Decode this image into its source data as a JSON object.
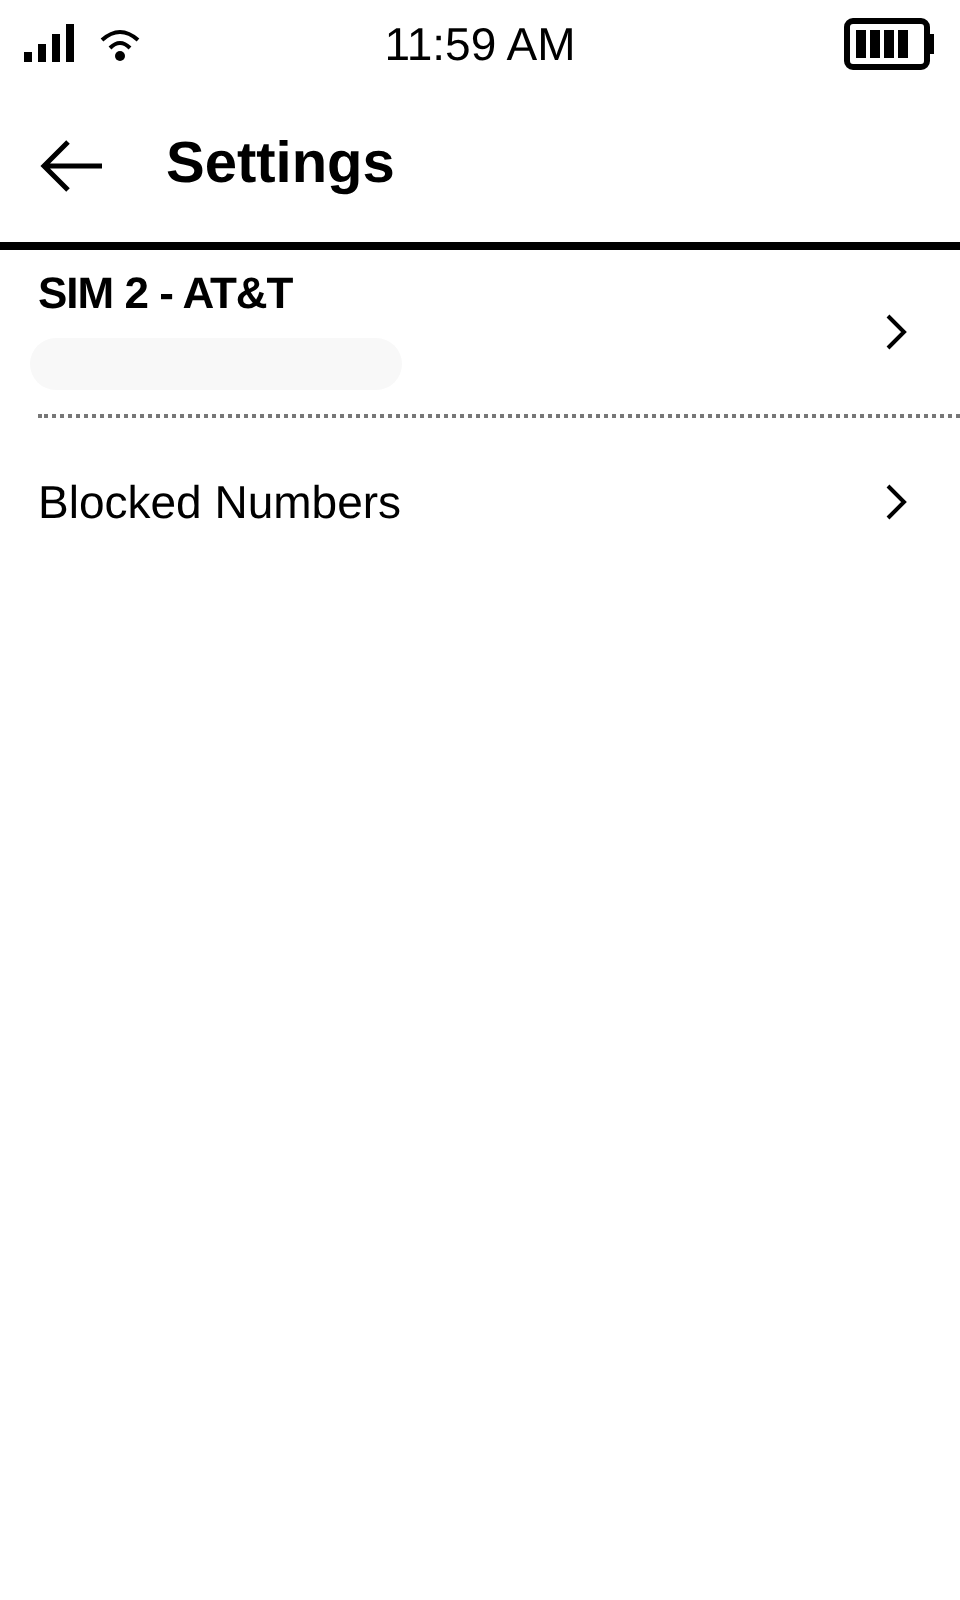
{
  "status_bar": {
    "time": "11:59 AM"
  },
  "header": {
    "title": "Settings"
  },
  "items": [
    {
      "kind": "sim",
      "label": "SIM 2 - AT&T"
    },
    {
      "kind": "plain",
      "label": "Blocked Numbers"
    }
  ]
}
